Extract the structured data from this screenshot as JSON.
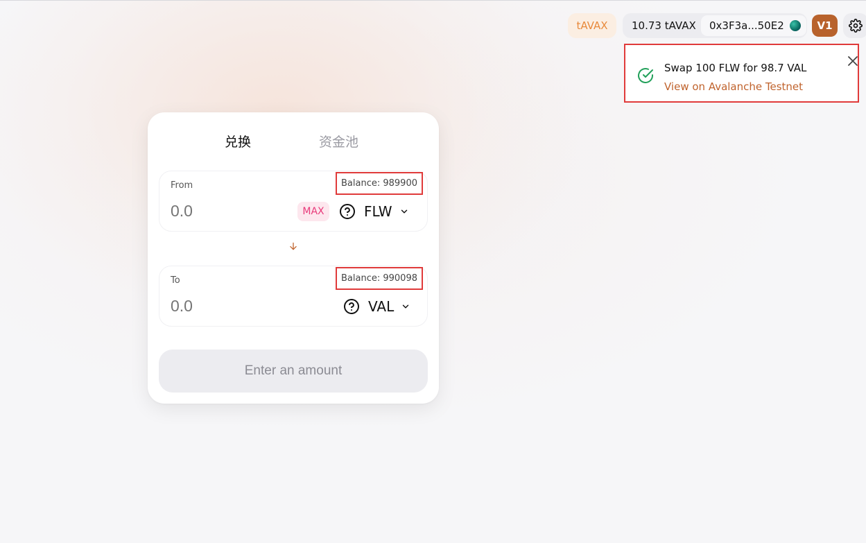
{
  "header": {
    "network": "tAVAX",
    "balance": "10.73 tAVAX",
    "address": "0x3F3a...50E2",
    "version": "V1",
    "icons": {
      "settings": "gear-icon",
      "avatar": "identicon-icon"
    }
  },
  "toast": {
    "title": "Swap 100 FLW for 98.7 VAL",
    "link": "View on Avalanche Testnet",
    "icons": {
      "status": "check-circle-icon",
      "close": "close-icon"
    }
  },
  "card": {
    "tabs": [
      {
        "label": "兑换",
        "active": true
      },
      {
        "label": "资金池",
        "active": false
      }
    ],
    "from": {
      "label": "From",
      "balance": "Balance: 989900",
      "placeholder": "0.0",
      "max": "MAX",
      "token": "FLW"
    },
    "to": {
      "label": "To",
      "balance": "Balance: 990098",
      "placeholder": "0.0",
      "token": "VAL"
    },
    "submit": "Enter an amount"
  },
  "colors": {
    "accent": "#c0632d",
    "success": "#22a05a",
    "max_bg": "#fde7ee",
    "max_text": "#e83a7a",
    "highlight_border": "#e03a3a"
  }
}
